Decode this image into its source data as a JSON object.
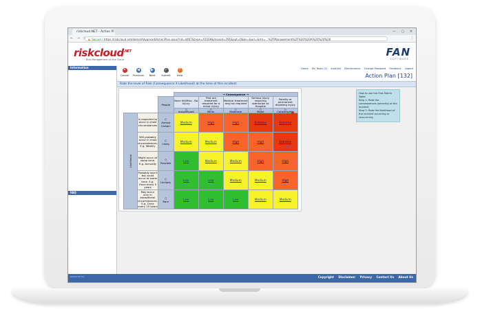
{
  "browser": {
    "tab_title": "riskcloud.NET - Action Pl",
    "url_secure": "Secure",
    "url": "https://riskcloud.net/demo/Advanced/ActionPlan.aspx?rid=4467&type=A1169&itypeid=291&apt=0&ky=&url=&rtn=...%2FManagement%2F%20%20A%20%20%20"
  },
  "header": {
    "logo": "riskcloud",
    "logo_suffix": ".NET",
    "tagline": "Risk Management on the Cloud",
    "brand": "FAN",
    "brand_sub": "SOFTWARE"
  },
  "sidebar": {
    "information_label": "Information",
    "faq_label": "FAQ"
  },
  "toolbar": {
    "buttons": [
      {
        "label": "Cancel",
        "color": "#cc2b2b",
        "glyph": "✕"
      },
      {
        "label": "Previous",
        "color": "#3a6fb5",
        "glyph": "◀"
      },
      {
        "label": "Next",
        "color": "#3a6fb5",
        "glyph": "▶"
      },
      {
        "label": "Submit",
        "color": "#555555",
        "glyph": "✓"
      },
      {
        "label": "Help",
        "color": "#e86a1a",
        "glyph": "?"
      }
    ],
    "links": [
      "Home",
      "My Tasks (2)",
      "Analysis",
      "Maintenance",
      "Change Password",
      "Feedback",
      "Logout"
    ],
    "page_title": "Action Plan [132]"
  },
  "instruction": "Rate the level of Risk (Consequence X Likelihood) at the time of this incident:",
  "matrix": {
    "consequence_label": "Consequence",
    "people_label": "People",
    "likelihood_label": "Likelihood",
    "consequences": [
      {
        "desc": "Near Hit/Miss - No Injury",
        "level": "Insignificant"
      },
      {
        "desc": "First aid treatment required for a minor injury",
        "level": "Minor"
      },
      {
        "desc": "Medical treatment may be required",
        "level": "Moderate"
      },
      {
        "desc": "Serious injury requiring admission to Hospital",
        "level": "Major"
      },
      {
        "desc": "Fatality or permanent disabling injury",
        "level": "Catastrophic"
      }
    ],
    "rows": [
      {
        "desc": "Is expected to occur in most circumstances",
        "name": "Almost Certain",
        "cells": [
          "Medium",
          "High",
          "High",
          "Extreme",
          "Extreme"
        ]
      },
      {
        "desc": "Will probably occur in most circumstances. E.g. Weekly",
        "name": "Likely",
        "cells": [
          "Medium",
          "Medium",
          "High",
          "High",
          "Extreme"
        ]
      },
      {
        "desc": "Might occur at some time. E.g. Annually",
        "name": "Possible",
        "cells": [
          "Low",
          "Medium",
          "Medium",
          "High",
          "High"
        ]
      },
      {
        "desc": "Probably won't but could occur at some time. E.g. Once every 5 years",
        "name": "Unlikely",
        "cells": [
          "Low",
          "Low",
          "Medium",
          "Medium",
          "High"
        ]
      },
      {
        "desc": "May occur only in exceptional circumstances. E.g. Once every 10 years",
        "name": "Rare",
        "cells": [
          "Low",
          "Low",
          "Low",
          "Medium",
          "Medium"
        ]
      }
    ]
  },
  "help": {
    "title": "How to use the Risk Matrix Table:",
    "step1": "Step 1: Rate the consequences (severity) of the incident",
    "step2": "Step 2: Rate the likelihood of the incident occurring or reoccurring"
  },
  "footer": {
    "powered": "powered by",
    "links": [
      "Copyright",
      "Disclaimer",
      "Privacy",
      "Contact Us",
      "About Us"
    ]
  }
}
